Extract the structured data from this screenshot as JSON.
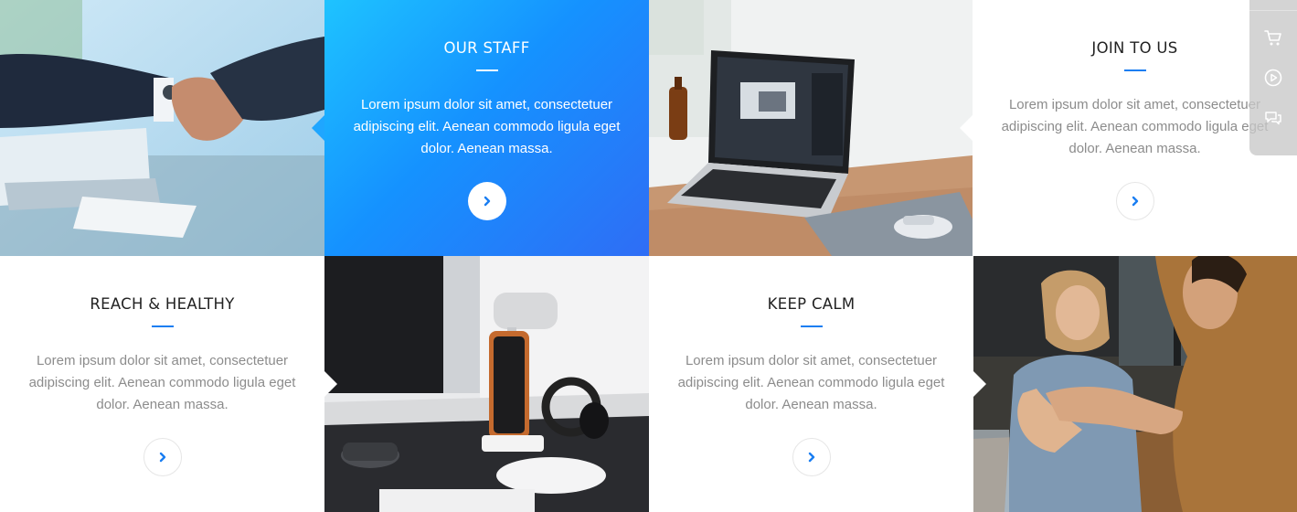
{
  "cards": [
    {
      "title": "OUR STAFF",
      "description": "Lorem ipsum dolor sit amet, consectetuer adipiscing elit. Aenean commodo ligula eget dolor. Aenean massa."
    },
    {
      "title": "JOIN TO US",
      "description": "Lorem ipsum dolor sit amet, consectetuer adipiscing elit. Aenean commodo ligula eget dolor. Aenean massa."
    },
    {
      "title": "REACH & HEALTHY",
      "description": "Lorem ipsum dolor sit amet, consectetuer adipiscing elit. Aenean commodo ligula eget dolor. Aenean massa."
    },
    {
      "title": "KEEP CALM",
      "description": "Lorem ipsum dolor sit amet, consectetuer adipiscing elit. Aenean commodo ligula eget dolor. Aenean massa."
    }
  ],
  "icons": {
    "card_button": "chevron-right-icon",
    "sidebar": [
      "cart-icon",
      "play-icon",
      "chat-icon"
    ]
  },
  "colors": {
    "accent": "#1a7ef2",
    "gradient_start": "#1ec3ff",
    "gradient_end": "#2f6df5",
    "title_text": "#222222",
    "body_text": "#8c8c8c"
  }
}
